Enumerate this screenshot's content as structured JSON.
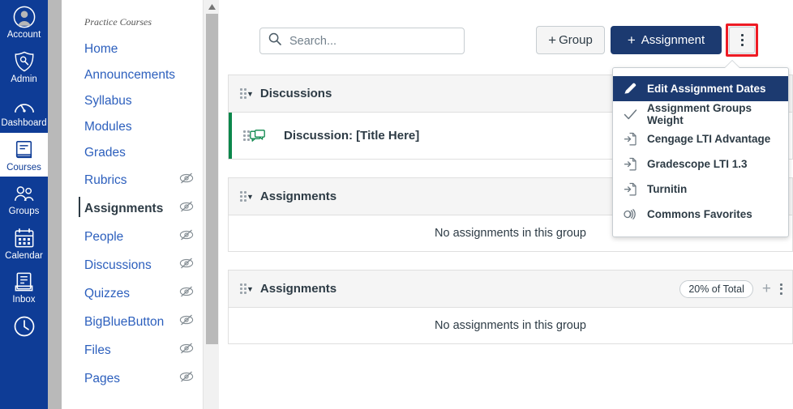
{
  "colors": {
    "brand_navy": "#0e3c96",
    "button_navy": "#1c3a70",
    "link_blue": "#2c5fbd",
    "highlight_red": "#ee1b24",
    "discussion_green": "#0b874b",
    "text_dark": "#2d3b45"
  },
  "global_nav": {
    "items": [
      {
        "label": "Account",
        "icon": "user-avatar-icon",
        "active": false
      },
      {
        "label": "Admin",
        "icon": "shield-wrench-icon",
        "active": false
      },
      {
        "label": "Dashboard",
        "icon": "dashboard-gauge-icon",
        "active": false
      },
      {
        "label": "Courses",
        "icon": "courses-book-icon",
        "active": true
      },
      {
        "label": "Groups",
        "icon": "groups-people-icon",
        "active": false
      },
      {
        "label": "Calendar",
        "icon": "calendar-icon",
        "active": false
      },
      {
        "label": "Inbox",
        "icon": "inbox-tray-icon",
        "active": false
      },
      {
        "label": "",
        "icon": "history-clock-icon",
        "active": false
      }
    ]
  },
  "course_nav": {
    "breadcrumb": "Practice Courses",
    "items": [
      {
        "label": "Home",
        "hidden_icon": false,
        "active": false
      },
      {
        "label": "Announcements",
        "hidden_icon": false,
        "active": false
      },
      {
        "label": "Syllabus",
        "hidden_icon": false,
        "active": false
      },
      {
        "label": "Modules",
        "hidden_icon": false,
        "active": false
      },
      {
        "label": "Grades",
        "hidden_icon": false,
        "active": false
      },
      {
        "label": "Rubrics",
        "hidden_icon": true,
        "active": false
      },
      {
        "label": "Assignments",
        "hidden_icon": true,
        "active": true
      },
      {
        "label": "People",
        "hidden_icon": true,
        "active": false
      },
      {
        "label": "Discussions",
        "hidden_icon": true,
        "active": false
      },
      {
        "label": "Quizzes",
        "hidden_icon": true,
        "active": false
      },
      {
        "label": "BigBlueButton",
        "hidden_icon": true,
        "active": false
      },
      {
        "label": "Files",
        "hidden_icon": true,
        "active": false
      },
      {
        "label": "Pages",
        "hidden_icon": true,
        "active": false
      }
    ]
  },
  "toolbar": {
    "search_placeholder": "Search...",
    "search_value": "",
    "group_button": "+Group",
    "group_plus": "+",
    "group_text": "Group",
    "assignment_plus": "+",
    "assignment_text": "Assignment",
    "kebab_label": "More options"
  },
  "menu": {
    "items": [
      {
        "label": "Edit Assignment Dates",
        "icon": "pencil-icon",
        "selected": true
      },
      {
        "label": "Assignment Groups Weight",
        "icon": "check-icon",
        "selected": false
      },
      {
        "label": "Cengage LTI Advantage",
        "icon": "lti-import-icon",
        "selected": false
      },
      {
        "label": "Gradescope LTI 1.3",
        "icon": "lti-import-icon",
        "selected": false
      },
      {
        "label": "Turnitin",
        "icon": "lti-import-icon",
        "selected": false
      },
      {
        "label": "Commons Favorites",
        "icon": "commons-icon",
        "selected": false
      }
    ]
  },
  "groups": [
    {
      "title": "Discussions",
      "weight": "",
      "show_actions": false,
      "empty_text": "",
      "rows": [
        {
          "title": "Discussion: [Title Here]",
          "icon": "discussion-icon"
        }
      ]
    },
    {
      "title": "Assignments",
      "weight": "",
      "show_actions": false,
      "empty_text": "No assignments in this group",
      "rows": []
    },
    {
      "title": "Assignments",
      "weight": "20% of Total",
      "show_actions": true,
      "empty_text": "No assignments in this group",
      "rows": []
    }
  ]
}
